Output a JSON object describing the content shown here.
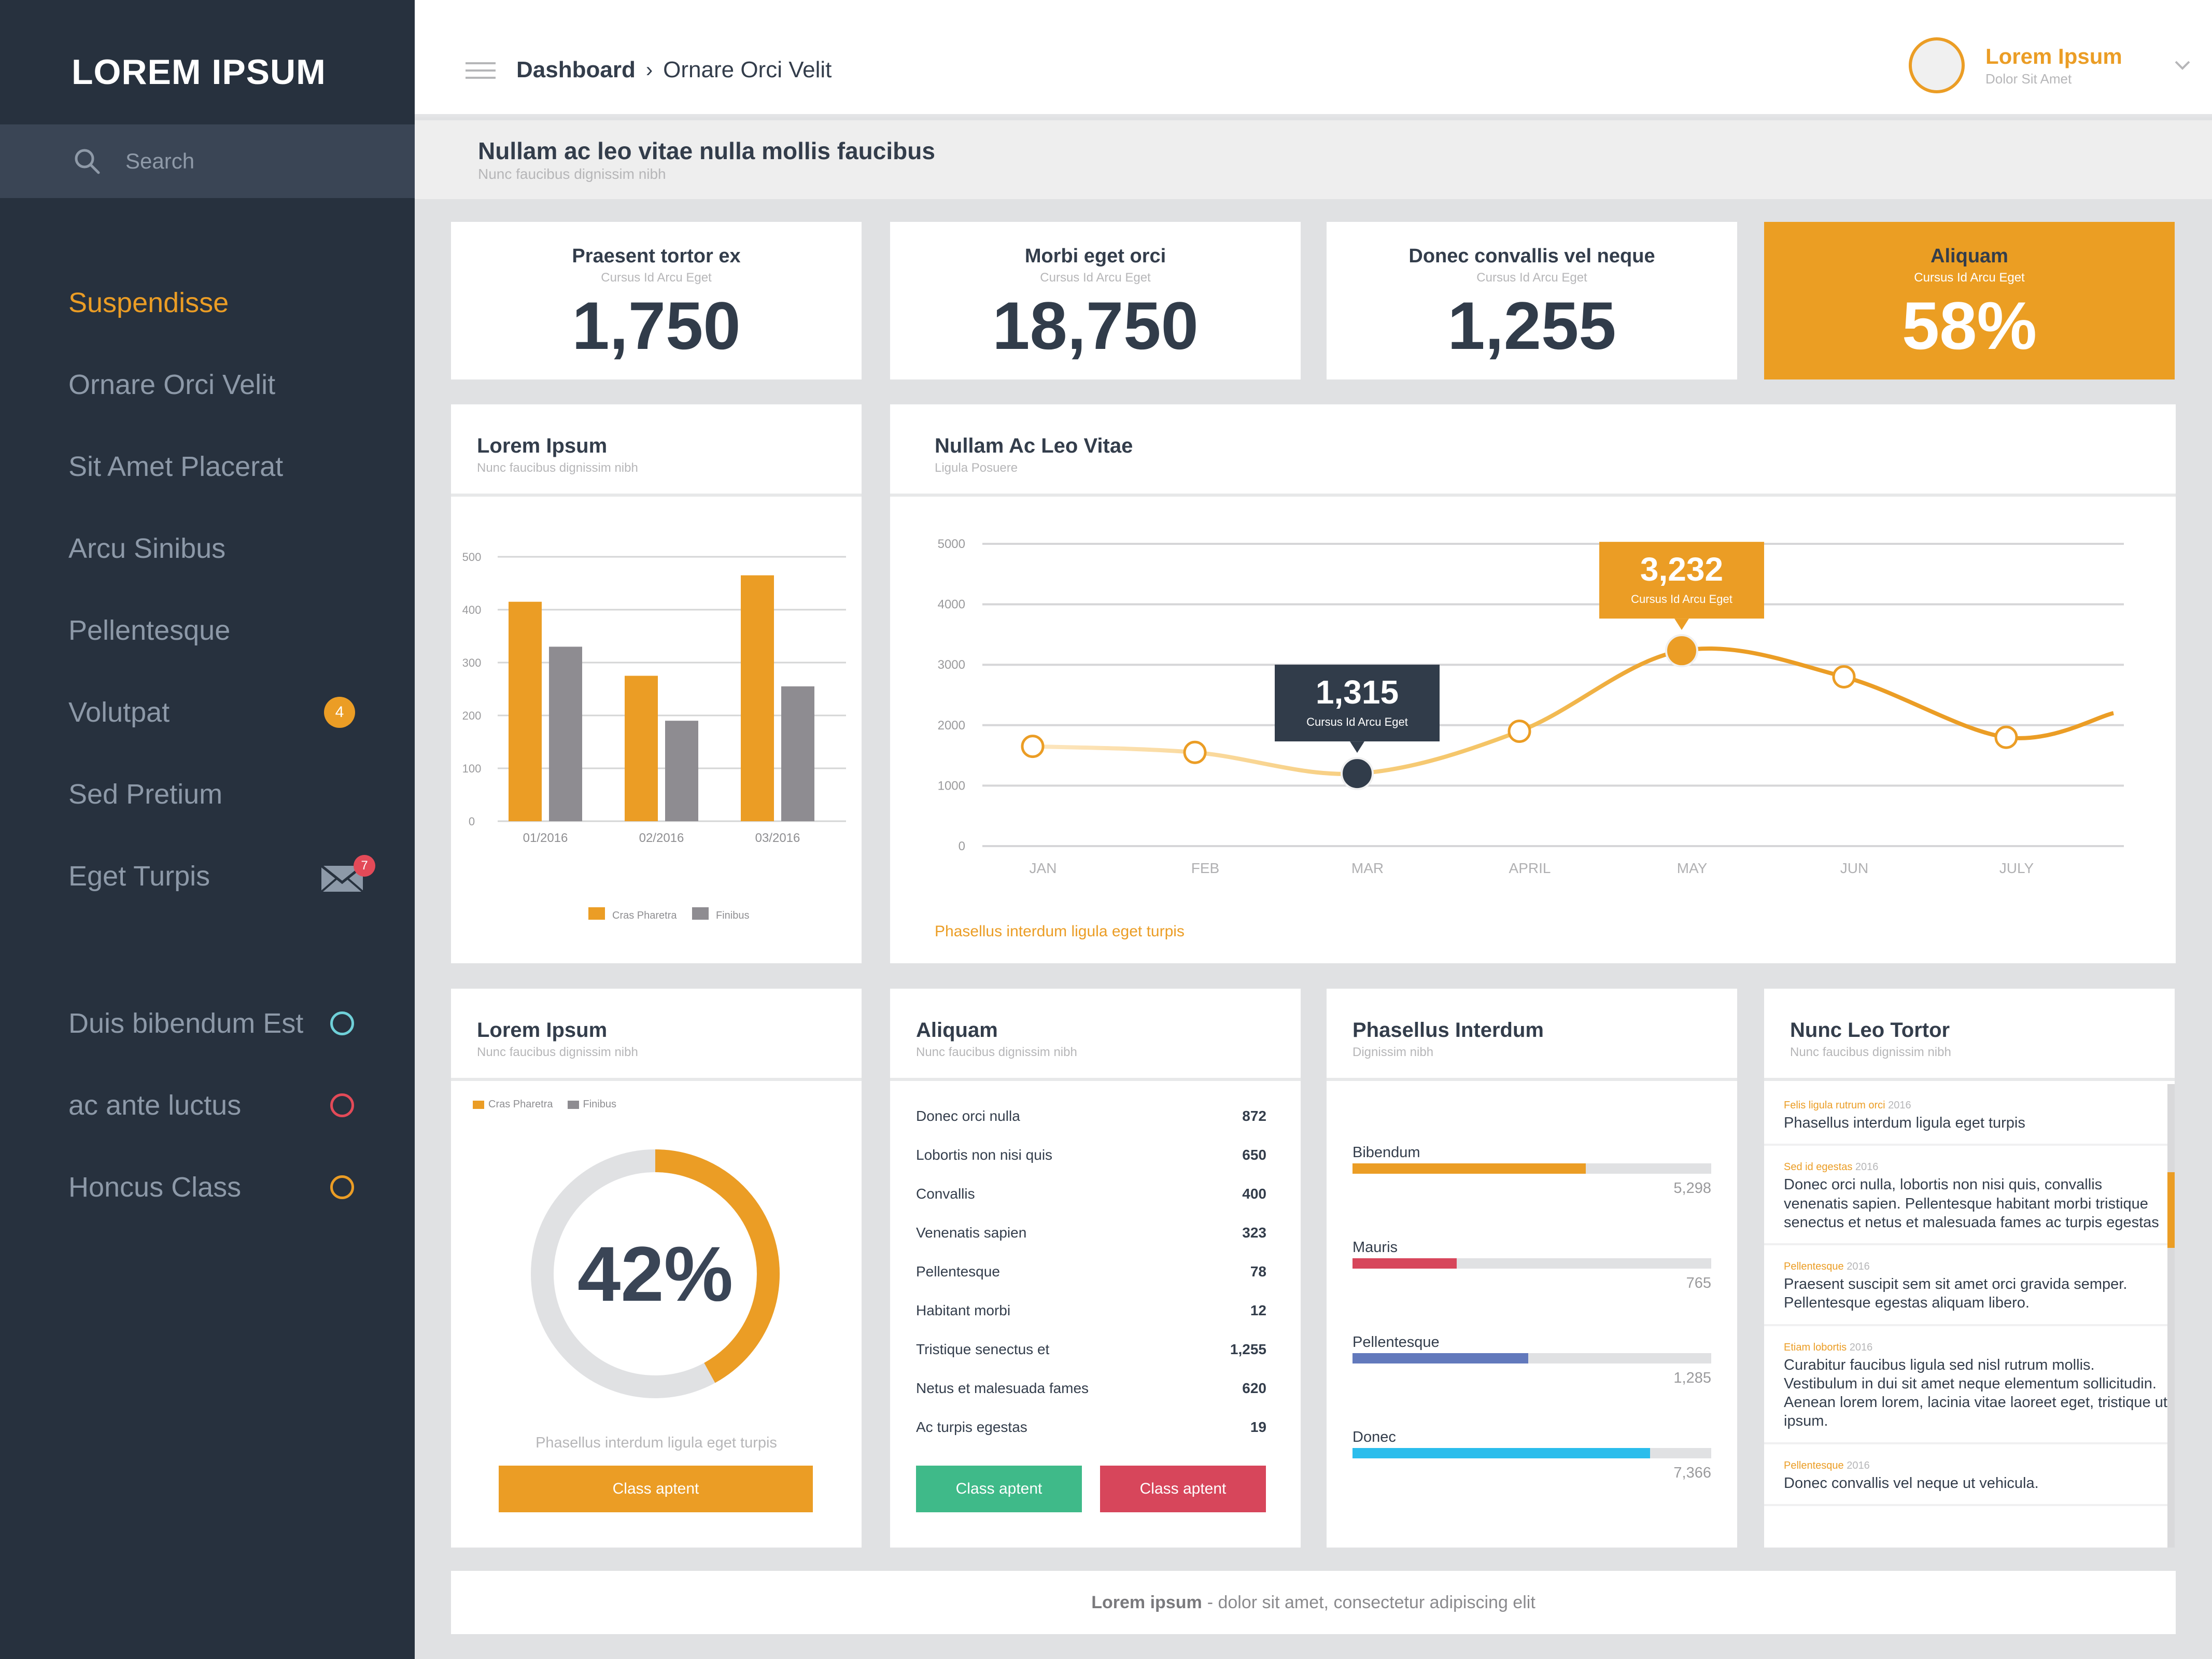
{
  "brand": "LOREM IPSUM",
  "search": {
    "placeholder": "Search",
    "icon": "search-icon"
  },
  "sidebar": {
    "items": [
      {
        "label": "Suspendisse",
        "active": true
      },
      {
        "label": "Ornare Orci Velit"
      },
      {
        "label": "Sit Amet Placerat"
      },
      {
        "label": "Arcu Sinibus"
      },
      {
        "label": "Pellentesque"
      },
      {
        "label": "Volutpat",
        "badge": "4"
      },
      {
        "label": "Sed Pretium"
      },
      {
        "label": "Eget Turpis",
        "icon": "mail-icon",
        "badge": "7"
      }
    ],
    "secondary": [
      {
        "label": "Duis bibendum Est",
        "color": "#6fd0d8"
      },
      {
        "label": "ac ante luctus",
        "color": "#e34a58"
      },
      {
        "label": "Honcus Class",
        "color": "#eb9d25"
      }
    ]
  },
  "header": {
    "breadcrumb": {
      "home": "Dashboard",
      "separator": "›",
      "current": "Ornare Orci Velit"
    },
    "user": {
      "name": "Lorem Ipsum",
      "role": "Dolor Sit Amet"
    }
  },
  "page": {
    "title": "Nullam ac leo vitae nulla mollis faucibus",
    "subtitle": "Nunc faucibus dignissim nibh"
  },
  "stats": [
    {
      "title": "Praesent tortor ex",
      "subtitle": "Cursus Id Arcu Eget",
      "value": "1,750"
    },
    {
      "title": "Morbi eget orci",
      "subtitle": "Cursus Id Arcu Eget",
      "value": "18,750"
    },
    {
      "title": "Donec convallis vel neque",
      "subtitle": "Cursus Id Arcu Eget",
      "value": "1,255"
    },
    {
      "title": "Aliquam",
      "subtitle": "Cursus Id Arcu Eget",
      "value": "58%",
      "highlight": true
    }
  ],
  "colors": {
    "accent": "#eb9d25",
    "gray": "#8e8c91",
    "dark": "#313c4a",
    "green": "#3fba89",
    "red": "#d7465b",
    "blue": "#6279bc",
    "cyan": "#2bbdec"
  },
  "bar_card": {
    "title": "Lorem Ipsum",
    "subtitle": "Nunc faucibus dignissim nibh"
  },
  "line_card": {
    "title": "Nullam Ac Leo Vitae",
    "subtitle": "Ligula Posuere",
    "footer": "Phasellus interdum ligula eget turpis"
  },
  "chart_data": [
    {
      "type": "bar",
      "title": "Lorem Ipsum",
      "categories": [
        "01/2016",
        "02/2016",
        "03/2016"
      ],
      "series": [
        {
          "name": "Cras Pharetra",
          "color": "#eb9d25",
          "values": [
            415,
            275,
            465
          ]
        },
        {
          "name": "Finibus",
          "color": "#8e8c91",
          "values": [
            330,
            190,
            255
          ]
        }
      ],
      "yticks": [
        0,
        100,
        200,
        300,
        400,
        500
      ],
      "ylim": [
        0,
        500
      ],
      "grid": true,
      "legend": "bottom"
    },
    {
      "type": "line",
      "title": "Nullam Ac Leo Vitae",
      "categories": [
        "JAN",
        "FEB",
        "MAR",
        "APRIL",
        "MAY",
        "JUN",
        "JULY"
      ],
      "series": [
        {
          "name": "Ligula Posuere",
          "values": [
            1650,
            1550,
            1200,
            1900,
            3232,
            2800,
            1800
          ]
        }
      ],
      "yticks": [
        0,
        1000,
        2000,
        3000,
        4000,
        5000
      ],
      "ylim": [
        0,
        5000
      ],
      "grid": true,
      "annotations": [
        {
          "category": "MAR",
          "value": "1,315",
          "label": "Cursus Id Arcu Eget",
          "style": "dark"
        },
        {
          "category": "MAY",
          "value": "3,232",
          "label": "Cursus Id Arcu Eget",
          "style": "accent"
        }
      ]
    },
    {
      "type": "pie",
      "title": "Lorem Ipsum",
      "subtitle": "Nunc faucibus dignissim nibh",
      "center_label": "42%",
      "slices": [
        {
          "name": "Cras Pharetra",
          "value": 42,
          "color": "#eb9d25"
        },
        {
          "name": "Finibus",
          "value": 58,
          "color": "#e0e1e3"
        }
      ],
      "legend": "top-left"
    }
  ],
  "donut_card": {
    "title": "Lorem Ipsum",
    "subtitle": "Nunc faucibus dignissim nibh",
    "legend": [
      "Cras Pharetra",
      "Finibus"
    ],
    "caption": "Phasellus interdum ligula eget turpis",
    "button": "Class aptent"
  },
  "table_card": {
    "title": "Aliquam",
    "subtitle": "Nunc faucibus dignissim nibh",
    "rows": [
      {
        "label": "Donec orci nulla",
        "value": "872"
      },
      {
        "label": "Lobortis non nisi quis",
        "value": "650"
      },
      {
        "label": "Convallis",
        "value": "400"
      },
      {
        "label": "Venenatis sapien",
        "value": "323"
      },
      {
        "label": "Pellentesque",
        "value": "78"
      },
      {
        "label": "Habitant morbi",
        "value": "12"
      },
      {
        "label": "Tristique senectus et",
        "value": "1,255"
      },
      {
        "label": "Netus et malesuada fames",
        "value": "620"
      },
      {
        "label": "Ac turpis egestas",
        "value": "19"
      }
    ],
    "buttons": [
      "Class aptent",
      "Class aptent"
    ]
  },
  "progress_card": {
    "title": "Phasellus Interdum",
    "subtitle": "Dignissim nibh",
    "items": [
      {
        "label": "Bibendum",
        "value": "5,298",
        "fraction": 0.65,
        "color": "#eb9d25"
      },
      {
        "label": "Mauris",
        "value": "765",
        "fraction": 0.29,
        "color": "#d7465b"
      },
      {
        "label": "Pellentesque",
        "value": "1,285",
        "fraction": 0.49,
        "color": "#6279bc"
      },
      {
        "label": "Donec",
        "value": "7,366",
        "fraction": 0.83,
        "color": "#2bbdec"
      }
    ]
  },
  "feed_card": {
    "title": "Nunc Leo Tortor",
    "subtitle": "Nunc faucibus dignissim nibh",
    "items": [
      {
        "tag": "Felis ligula rutrum orci",
        "year": "2016",
        "text": "Phasellus interdum ligula eget turpis"
      },
      {
        "tag": "Sed id egestas",
        "year": "2016",
        "text": "Donec orci nulla, lobortis non nisi quis, convallis venenatis sapien. Pellentesque habitant morbi tristique senectus et netus et malesuada fames ac turpis egestas"
      },
      {
        "tag": "Pellentesque",
        "year": "2016",
        "text": "Praesent suscipit sem sit amet orci gravida semper. Pellentesque egestas aliquam libero."
      },
      {
        "tag": "Etiam lobortis",
        "year": "2016",
        "text": "Curabitur faucibus ligula sed nisl rutrum mollis. Vestibulum in dui sit amet neque elementum sollicitudin. Aenean lorem lorem, lacinia vitae laoreet eget, tristique ut ipsum."
      },
      {
        "tag": "Pellentesque",
        "year": "2016",
        "text": "Donec convallis vel neque ut vehicula."
      }
    ]
  },
  "footer": {
    "bold": "Lorem ipsum",
    "text": "- dolor sit amet, consectetur adipiscing elit"
  }
}
